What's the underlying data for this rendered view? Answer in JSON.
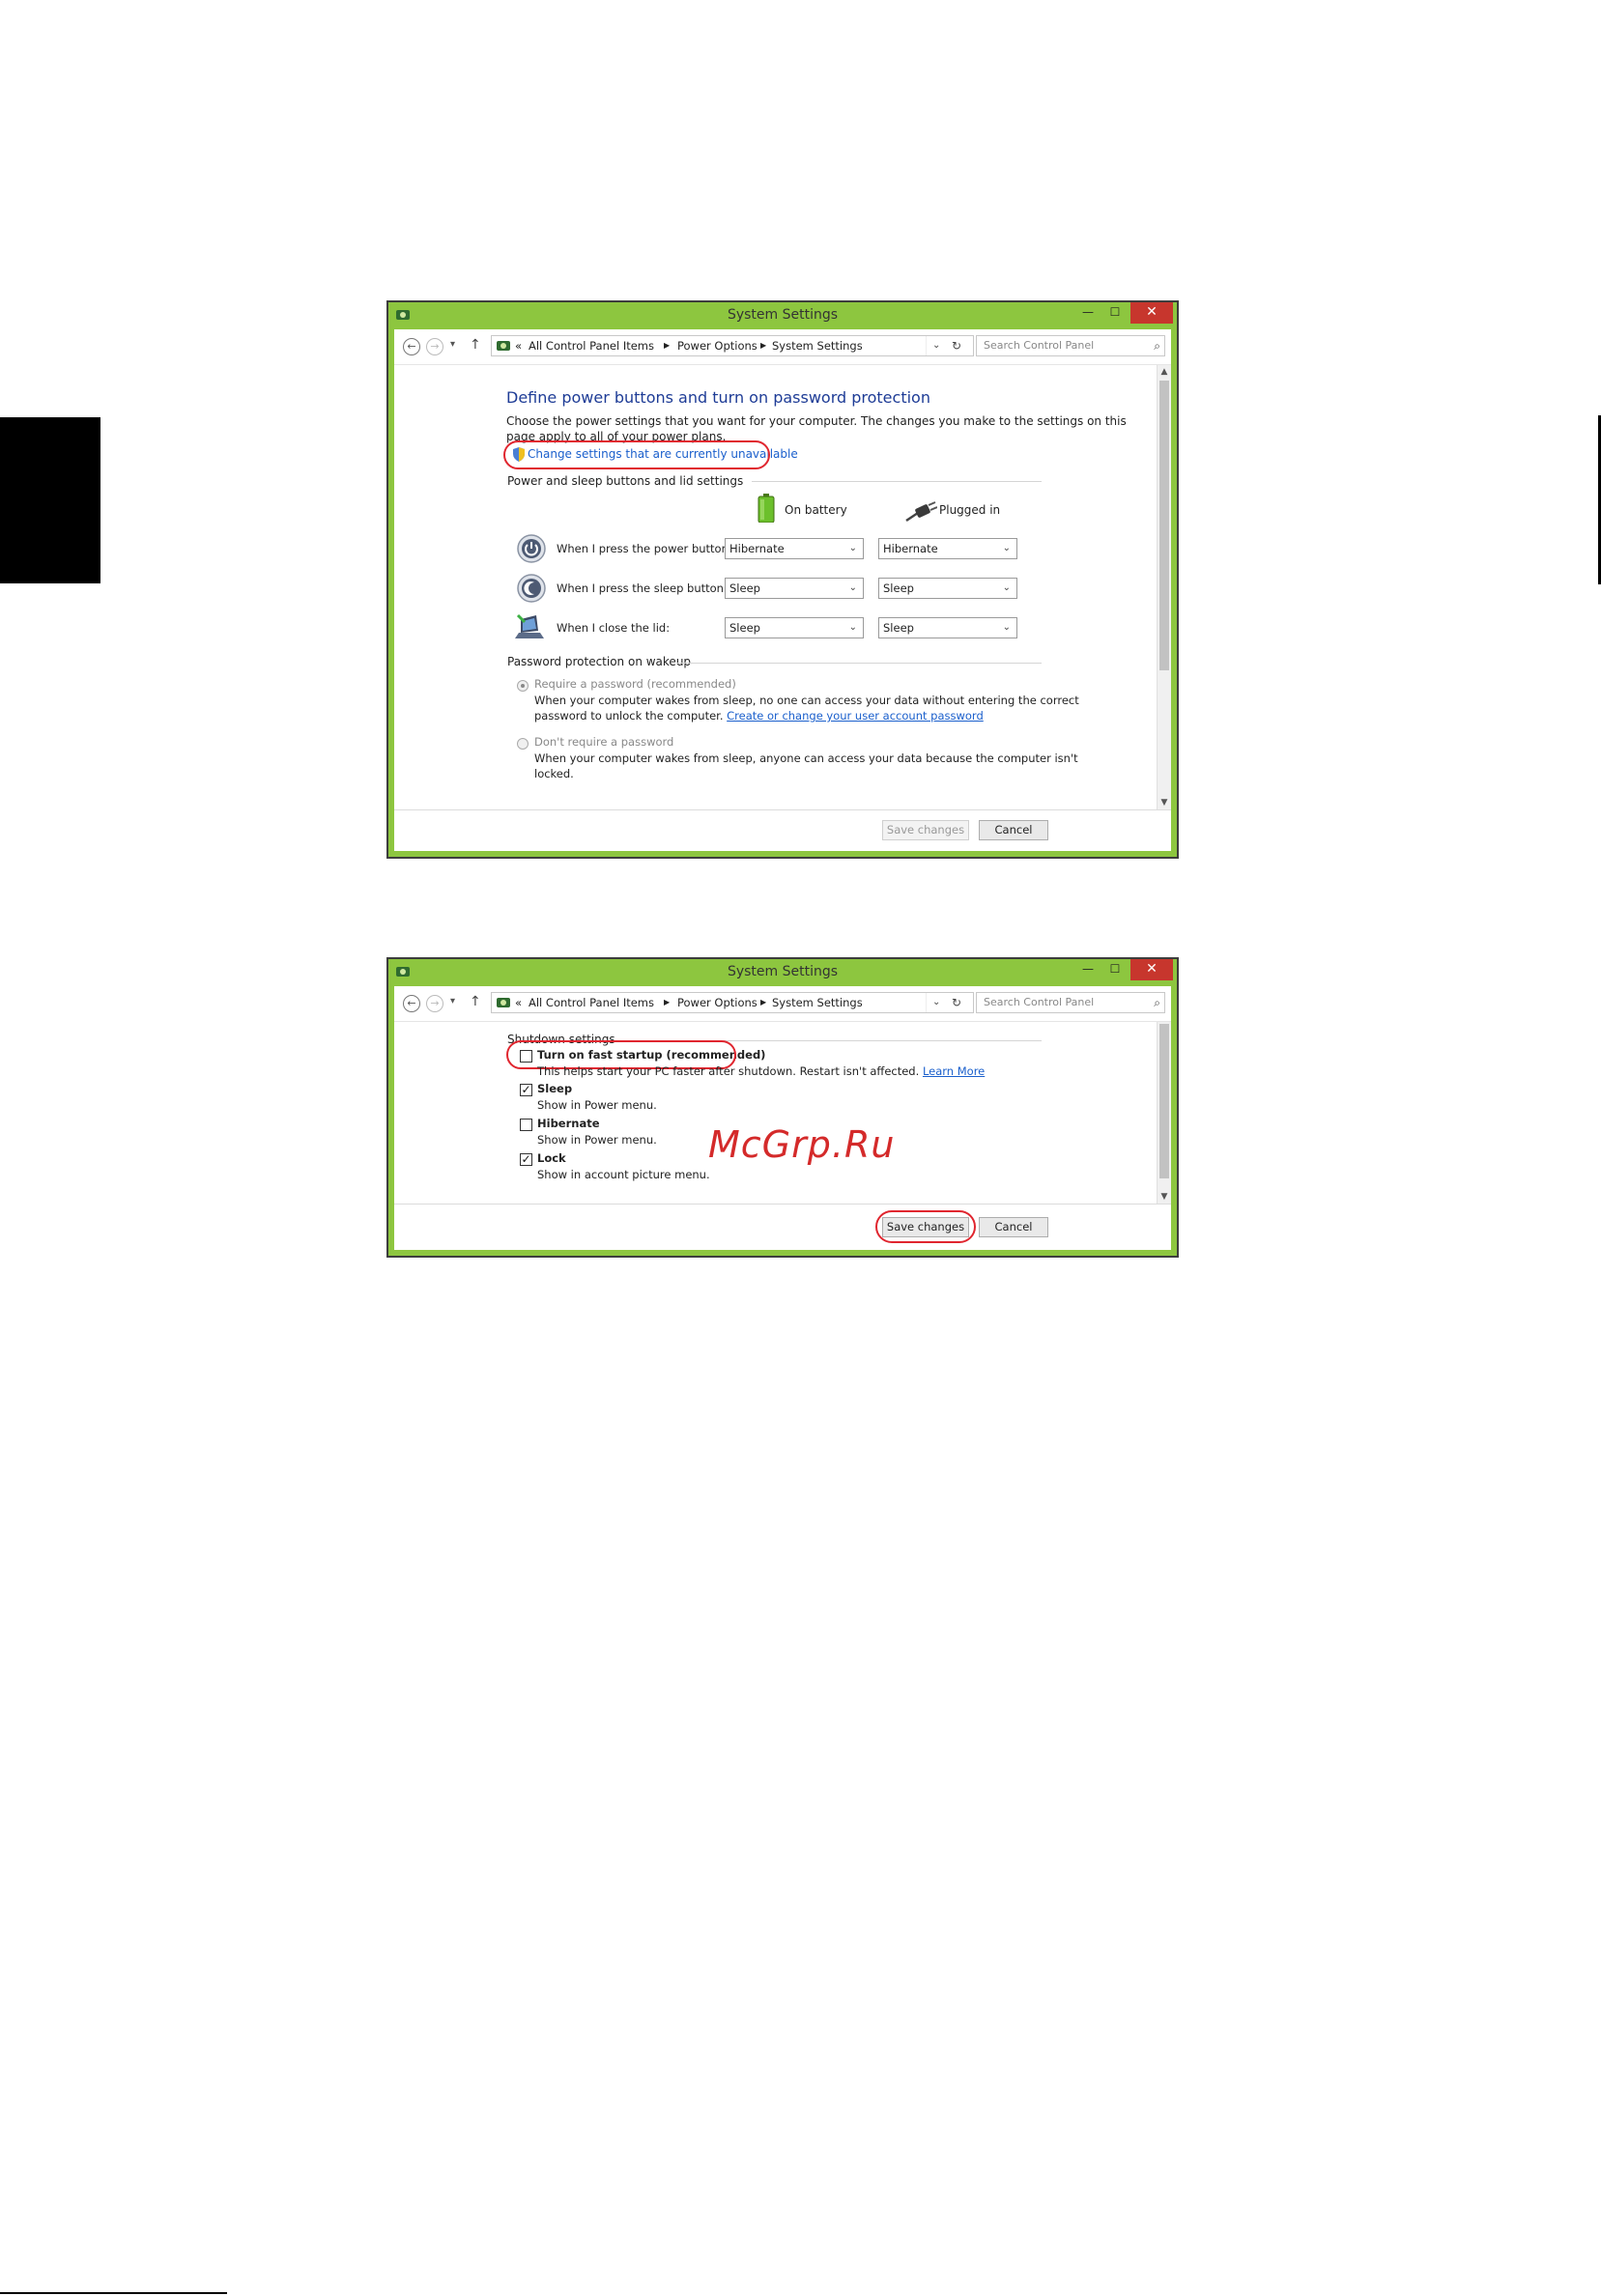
{
  "window_title": "System Settings",
  "controls": {
    "minimize": "—",
    "maximize": "☐",
    "close": "✕"
  },
  "navbar": {
    "recent_chevron": "«",
    "breadcrumb": [
      "All Control Panel Items",
      "Power Options",
      "System Settings"
    ],
    "search_placeholder": "Search Control Panel"
  },
  "screen1": {
    "heading": "Define power buttons and turn on password protection",
    "intro_line1": "Choose the power settings that you want for your computer. The changes you make to the settings on this",
    "intro_line2": "page apply to all of your power plans.",
    "change_link": "Change settings that are currently unavailable",
    "section_buttons": "Power and sleep buttons and lid settings",
    "col_battery": "On battery",
    "col_plugged": "Plugged in",
    "rows": [
      {
        "label": "When I press the power button:",
        "battery": "Hibernate",
        "plugged": "Hibernate"
      },
      {
        "label": "When I press the sleep button:",
        "battery": "Sleep",
        "plugged": "Sleep"
      },
      {
        "label": "When I close the lid:",
        "battery": "Sleep",
        "plugged": "Sleep"
      }
    ],
    "section_password": "Password protection on wakeup",
    "require_label": "Require a password (recommended)",
    "require_desc1": "When your computer wakes from sleep, no one can access your data without entering the correct",
    "require_desc2": "password to unlock the computer.",
    "require_link": "Create or change your user account password",
    "norequire_label": "Don't require a password",
    "norequire_desc1": "When your computer wakes from sleep, anyone can access your data because the computer isn't",
    "norequire_desc2": "locked.",
    "save": "Save changes",
    "cancel": "Cancel"
  },
  "screen2": {
    "section_shutdown": "Shutdown settings",
    "fast_startup": "Turn on fast startup (recommended)",
    "fast_startup_desc": "This helps start your PC faster after shutdown. Restart isn't affected.",
    "learn_more": "Learn More",
    "sleep_label": "Sleep",
    "sleep_desc": "Show in Power menu.",
    "hibernate_label": "Hibernate",
    "hibernate_desc": "Show in Power menu.",
    "lock_label": "Lock",
    "lock_desc": "Show in account picture menu.",
    "checked_mark": "✓",
    "save": "Save changes",
    "cancel": "Cancel"
  },
  "watermark": "McGrp.Ru",
  "colors": {
    "frame": "#8dc63f",
    "close": "#c7362d",
    "highlight": "#e0262f",
    "link": "#1a5fcc",
    "heading": "#1e3c96"
  }
}
